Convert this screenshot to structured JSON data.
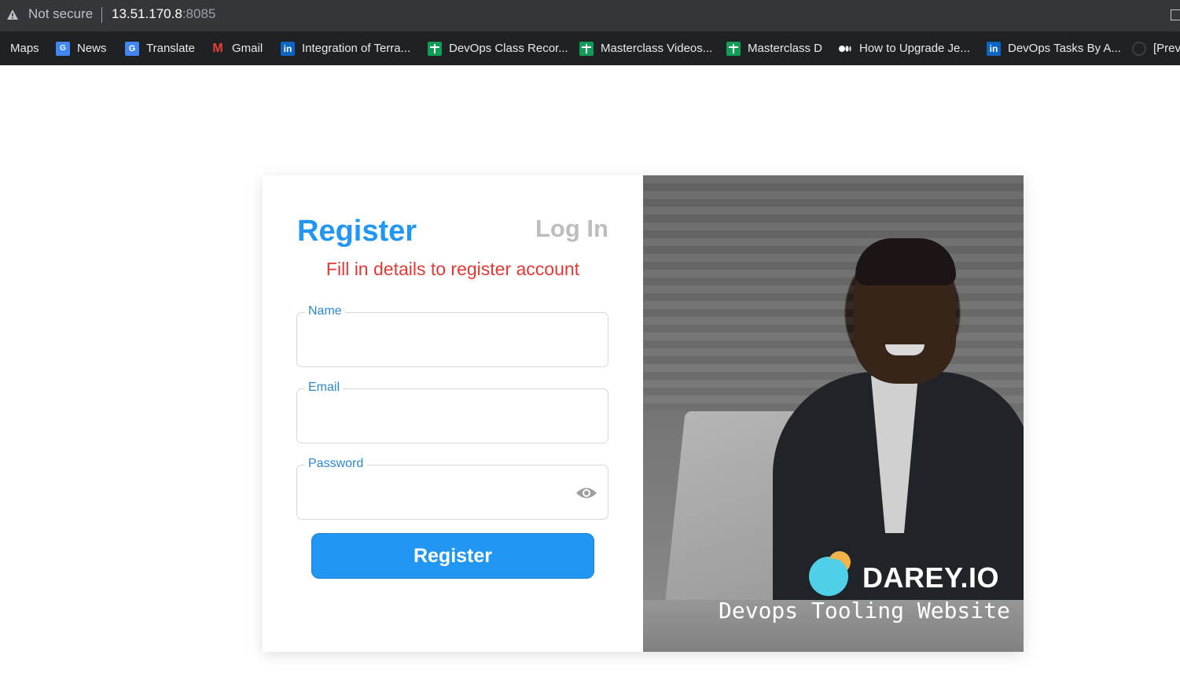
{
  "browser": {
    "security_label": "Not secure",
    "host": "13.51.170.8",
    "port": ":8085"
  },
  "bookmarks": [
    {
      "label": "Maps",
      "icon": "maps-icon"
    },
    {
      "label": "News",
      "icon": "google-news-icon"
    },
    {
      "label": "Translate",
      "icon": "google-translate-icon"
    },
    {
      "label": "Gmail",
      "icon": "gmail-icon"
    },
    {
      "label": "Integration of Terra...",
      "icon": "linkedin-icon"
    },
    {
      "label": "DevOps Class Recor...",
      "icon": "google-sheets-icon"
    },
    {
      "label": "Masterclass Videos...",
      "icon": "google-sheets-icon"
    },
    {
      "label": "Masterclass D",
      "icon": "google-sheets-icon"
    },
    {
      "label": "How to Upgrade Je...",
      "icon": "medium-icon"
    },
    {
      "label": "DevOps Tasks By A...",
      "icon": "linkedin-icon"
    },
    {
      "label": "[Prev",
      "icon": "github-icon"
    }
  ],
  "form": {
    "tab_register": "Register",
    "tab_login": "Log In",
    "subtitle": "Fill in details to register account",
    "fields": {
      "name": {
        "label": "Name",
        "value": ""
      },
      "email": {
        "label": "Email",
        "value": ""
      },
      "password": {
        "label": "Password",
        "value": ""
      }
    },
    "submit_label": "Register"
  },
  "hero": {
    "brand": "DAREY.IO",
    "tagline": "Devops Tooling Website"
  },
  "colors": {
    "accent": "#2196f3",
    "error": "#e53935",
    "muted_tab": "#bdbdbd"
  }
}
